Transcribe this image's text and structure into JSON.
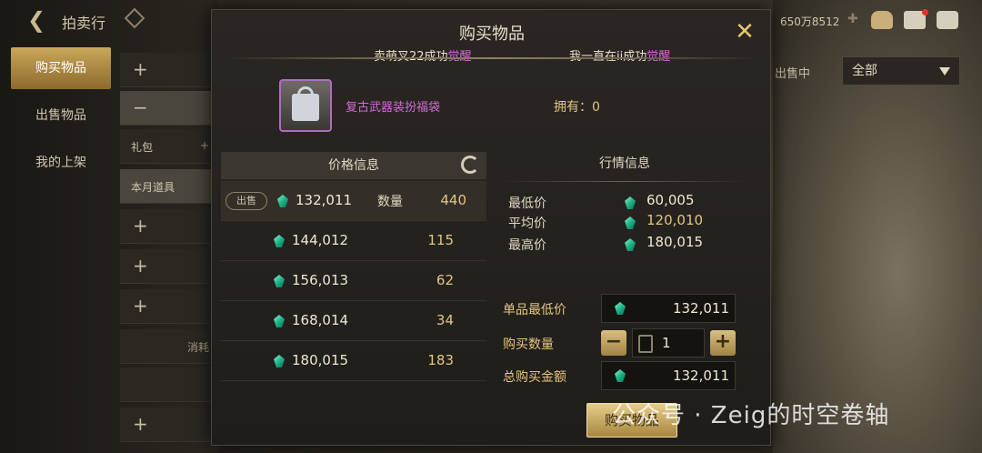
{
  "topbar": {
    "title": "拍卖行",
    "currency": "650万8512"
  },
  "sidebar": {
    "items": [
      {
        "label": "购买物品"
      },
      {
        "label": "出售物品"
      },
      {
        "label": "我的上架"
      }
    ]
  },
  "categories": {
    "gift_label": "礼包",
    "month_label": "本月道具",
    "consume_label": "消耗"
  },
  "filter": {
    "label": "出售中",
    "selected": "全部"
  },
  "modal": {
    "title": "购买物品",
    "banner1": "卖萌叉22成功",
    "banner2": "我一直在ii成功",
    "awaken": "觉醒",
    "item_name": "复古武器装扮福袋",
    "owned": "拥有：0",
    "price_header": "价格信息",
    "sell_tag": "出售",
    "qty_label": "数量",
    "prices": [
      {
        "price": "132,011",
        "qty": "440"
      },
      {
        "price": "144,012",
        "qty": "115"
      },
      {
        "price": "156,013",
        "qty": "62"
      },
      {
        "price": "168,014",
        "qty": "34"
      },
      {
        "price": "180,015",
        "qty": "183"
      }
    ],
    "market_header": "行情信息",
    "market": {
      "min_label": "最低价",
      "min_val": "60,005",
      "avg_label": "平均价",
      "avg_val": "120,010",
      "max_label": "最高价",
      "max_val": "180,015"
    },
    "unit_price_label": "单品最低价",
    "unit_price": "132,011",
    "buy_qty_label": "购买数量",
    "buy_qty": "1",
    "total_label": "总购买金额",
    "total": "132,011",
    "buy_button": "购买物品"
  },
  "watermark": "公众号 · Zeig的时空卷轴"
}
